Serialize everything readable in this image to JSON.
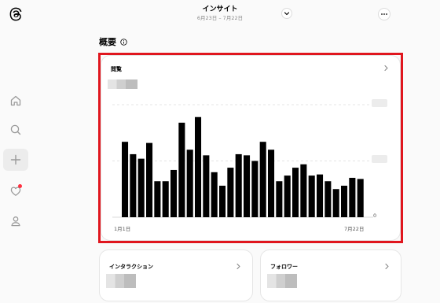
{
  "header": {
    "title": "インサイト",
    "dates": "6月23日 – 7月22日"
  },
  "overview": {
    "title": "概要"
  },
  "views_card": {
    "label": "閲覧",
    "y_tick_zero": "0",
    "x_start": "1月1日",
    "x_end": "7月22日"
  },
  "chart_data": {
    "type": "bar",
    "x_start_label": "1月1日",
    "x_end_label": "7月22日",
    "y_tick_labels": [
      "0"
    ],
    "values": [
      0.67,
      0.56,
      0.52,
      0.66,
      0.32,
      0.32,
      0.42,
      0.84,
      0.6,
      0.89,
      0.55,
      0.4,
      0.28,
      0.44,
      0.56,
      0.55,
      0.5,
      0.67,
      0.6,
      0.32,
      0.37,
      0.44,
      0.47,
      0.37,
      0.38,
      0.32,
      0.25,
      0.28,
      0.35,
      0.34
    ],
    "value_note": "values as fraction of the plot height (y-axis values are obscured)",
    "grid": true,
    "color": "#000000"
  },
  "interaction_card": {
    "label": "インタラクション"
  },
  "followers_card": {
    "label": "フォロワー"
  },
  "colors": {
    "highlight": "#e0161e",
    "notification": "#ff3040",
    "bar": "#000000"
  },
  "icons": [
    "threads-logo",
    "home-icon",
    "search-icon",
    "plus-icon",
    "heart-icon",
    "profile-icon",
    "chevron-down-icon",
    "more-icon",
    "info-icon",
    "chevron-right-icon"
  ]
}
